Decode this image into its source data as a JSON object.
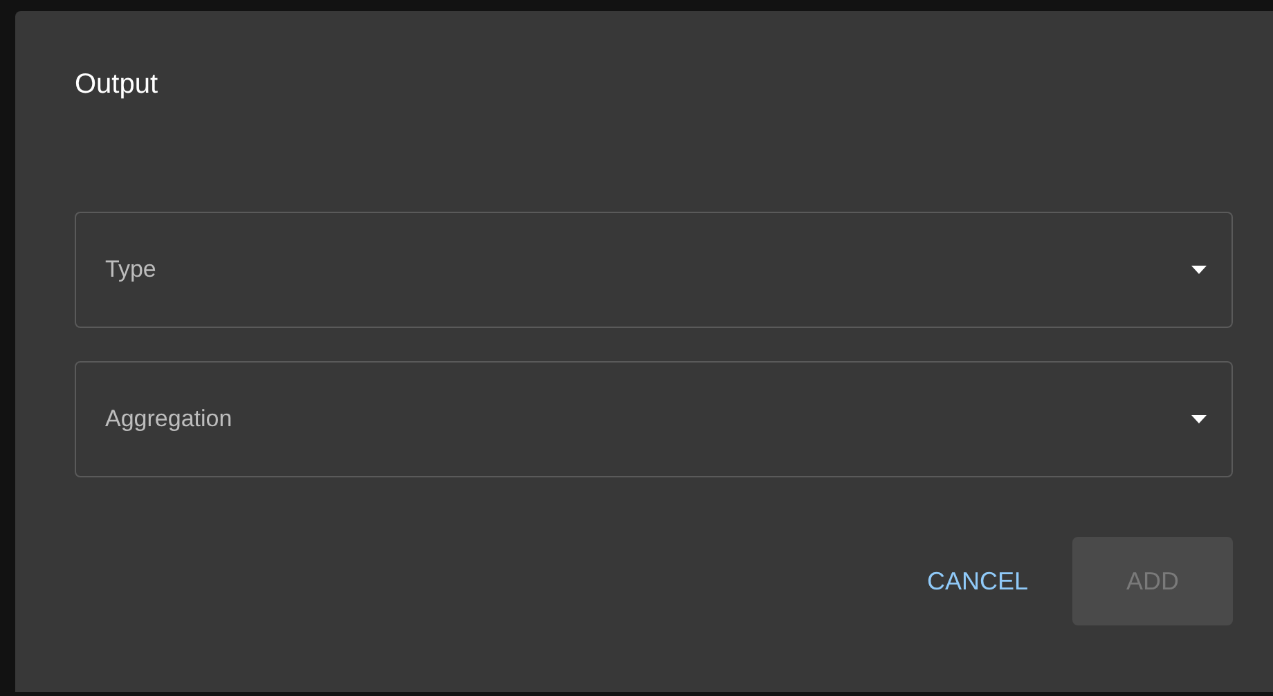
{
  "dialog": {
    "title": "Output",
    "fields": [
      {
        "label": "Type"
      },
      {
        "label": "Aggregation"
      }
    ],
    "buttons": [
      {
        "label": "CANCEL",
        "kind": "text",
        "disabled": false
      },
      {
        "label": "ADD",
        "kind": "contained",
        "disabled": true
      }
    ]
  }
}
